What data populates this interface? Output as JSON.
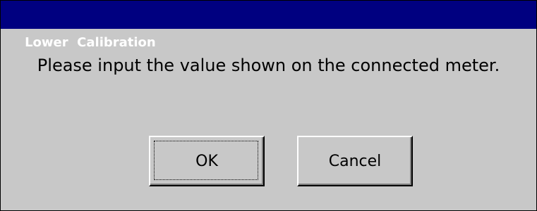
{
  "dialog": {
    "title": "Lower  Calibration",
    "message": "Please input the value shown on the connected meter.",
    "buttons": {
      "ok_label": "OK",
      "cancel_label": "Cancel"
    }
  },
  "colors": {
    "titlebar": "#000080",
    "title_text": "#ffffff",
    "body": "#c8c8c8"
  }
}
